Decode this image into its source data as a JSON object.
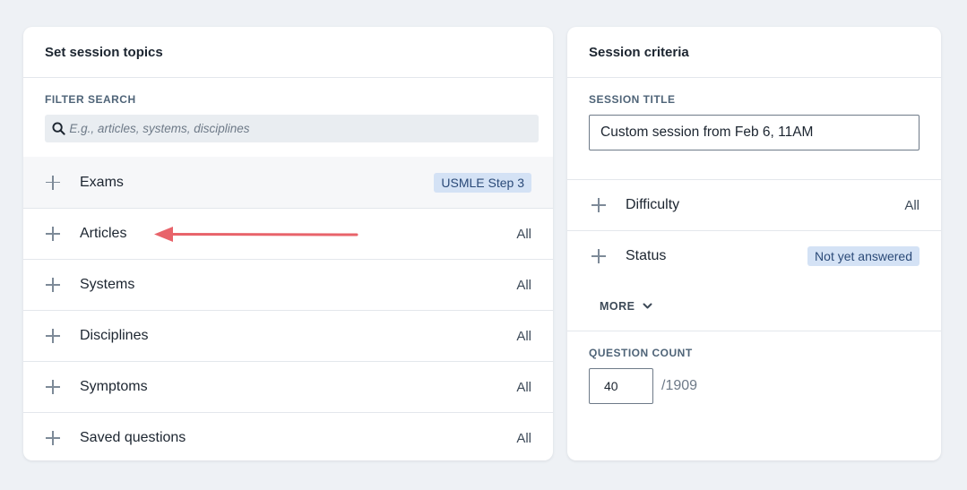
{
  "left_panel": {
    "title": "Set session topics",
    "filter_label": "FILTER SEARCH",
    "search_placeholder": "E.g., articles, systems, disciplines",
    "rows": [
      {
        "label": "Exams",
        "value": "USMLE Step 3",
        "style": "badge"
      },
      {
        "label": "Articles",
        "value": "All"
      },
      {
        "label": "Systems",
        "value": "All"
      },
      {
        "label": "Disciplines",
        "value": "All"
      },
      {
        "label": "Symptoms",
        "value": "All"
      },
      {
        "label": "Saved questions",
        "value": "All"
      }
    ]
  },
  "right_panel": {
    "title": "Session criteria",
    "session_title_label": "SESSION TITLE",
    "session_title_value": "Custom session from Feb 6, 11AM",
    "rows": [
      {
        "label": "Difficulty",
        "value": "All"
      },
      {
        "label": "Status",
        "value": "Not yet answered",
        "style": "badge"
      }
    ],
    "more_label": "MORE",
    "question_count_label": "QUESTION COUNT",
    "question_count_value": "40",
    "question_count_total": "/1909"
  },
  "colors": {
    "background": "#eef1f5",
    "badge_bg": "#d4e2f5",
    "badge_text": "#2b4a78",
    "annotation_arrow": "#e8636a"
  },
  "icons": [
    "search-icon",
    "plus-icon",
    "chevron-down-icon",
    "red-arrow-annotation"
  ]
}
